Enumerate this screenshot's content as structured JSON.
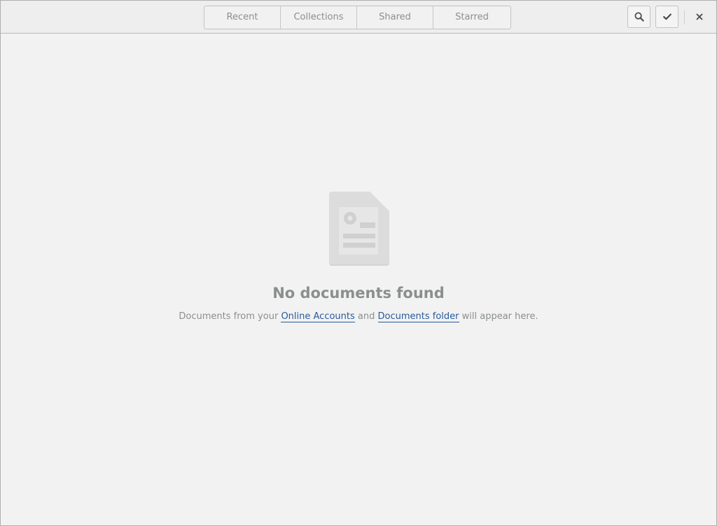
{
  "view_switcher": {
    "tabs": [
      {
        "label": "Recent"
      },
      {
        "label": "Collections"
      },
      {
        "label": "Shared"
      },
      {
        "label": "Starred"
      }
    ]
  },
  "header_buttons": {
    "search_icon": "magnifier-icon",
    "select_icon": "checkmark-icon",
    "close_icon": "close-x-icon"
  },
  "empty_state": {
    "icon": "document-icon",
    "title": "No documents found",
    "desc_prefix": "Documents from your ",
    "online_accounts_link": "Online Accounts",
    "desc_and": " and ",
    "documents_folder_link": "Documents folder",
    "desc_suffix": " will appear here."
  },
  "colors": {
    "background": "#f2f2f2",
    "text_dim": "#8b8e8f",
    "link": "#2a5a9a",
    "icon_gray": "#d6d6d6"
  }
}
